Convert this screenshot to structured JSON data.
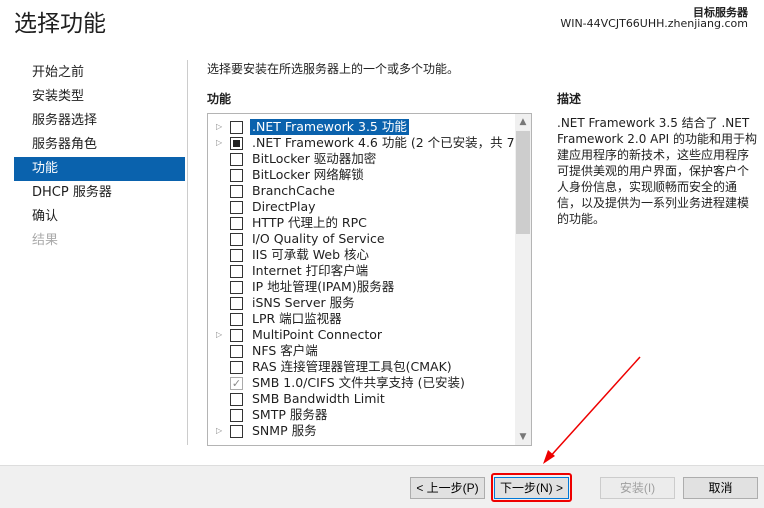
{
  "header": {
    "title": "选择功能",
    "target_label": "目标服务器",
    "target_server": "WIN-44VCJT66UHH.zhenjiang.com"
  },
  "nav": [
    {
      "label": "开始之前",
      "state": "normal"
    },
    {
      "label": "安装类型",
      "state": "normal"
    },
    {
      "label": "服务器选择",
      "state": "normal"
    },
    {
      "label": "服务器角色",
      "state": "normal"
    },
    {
      "label": "功能",
      "state": "selected"
    },
    {
      "label": "DHCP 服务器",
      "state": "normal"
    },
    {
      "label": "确认",
      "state": "normal"
    },
    {
      "label": "结果",
      "state": "disabled"
    }
  ],
  "main": {
    "instruction": "选择要安装在所选服务器上的一个或多个功能。",
    "features_heading": "功能",
    "features": [
      {
        "label": ".NET Framework 3.5 功能",
        "expandable": true,
        "check": "none",
        "selected": true
      },
      {
        "label": ".NET Framework 4.6 功能 (2 个已安装，共 7 个)",
        "expandable": true,
        "check": "partial"
      },
      {
        "label": "BitLocker 驱动器加密",
        "expandable": false,
        "check": "none"
      },
      {
        "label": "BitLocker 网络解锁",
        "expandable": false,
        "check": "none"
      },
      {
        "label": "BranchCache",
        "expandable": false,
        "check": "none"
      },
      {
        "label": "DirectPlay",
        "expandable": false,
        "check": "none"
      },
      {
        "label": "HTTP 代理上的 RPC",
        "expandable": false,
        "check": "none"
      },
      {
        "label": "I/O Quality of Service",
        "expandable": false,
        "check": "none"
      },
      {
        "label": "IIS 可承载 Web 核心",
        "expandable": false,
        "check": "none"
      },
      {
        "label": "Internet 打印客户端",
        "expandable": false,
        "check": "none"
      },
      {
        "label": "IP 地址管理(IPAM)服务器",
        "expandable": false,
        "check": "none"
      },
      {
        "label": "iSNS Server 服务",
        "expandable": false,
        "check": "none"
      },
      {
        "label": "LPR 端口监视器",
        "expandable": false,
        "check": "none"
      },
      {
        "label": "MultiPoint Connector",
        "expandable": true,
        "check": "none"
      },
      {
        "label": "NFS 客户端",
        "expandable": false,
        "check": "none"
      },
      {
        "label": "RAS 连接管理器管理工具包(CMAK)",
        "expandable": false,
        "check": "none"
      },
      {
        "label": "SMB 1.0/CIFS 文件共享支持 (已安装)",
        "expandable": false,
        "check": "installed"
      },
      {
        "label": "SMB Bandwidth Limit",
        "expandable": false,
        "check": "none"
      },
      {
        "label": "SMTP 服务器",
        "expandable": false,
        "check": "none"
      },
      {
        "label": "SNMP 服务",
        "expandable": true,
        "check": "none"
      }
    ],
    "description_heading": "描述",
    "description": ".NET Framework 3.5 结合了 .NET Framework 2.0 API 的功能和用于构建应用程序的新技术，这些应用程序可提供美观的用户界面，保护客户个人身份信息，实现顺畅而安全的通信，以及提供为一系列业务进程建模的功能。"
  },
  "footer": {
    "prev": "< 上一步(P)",
    "next": "下一步(N) >",
    "install": "安装(I)",
    "cancel": "取消"
  },
  "annotation_color": "#e00000"
}
